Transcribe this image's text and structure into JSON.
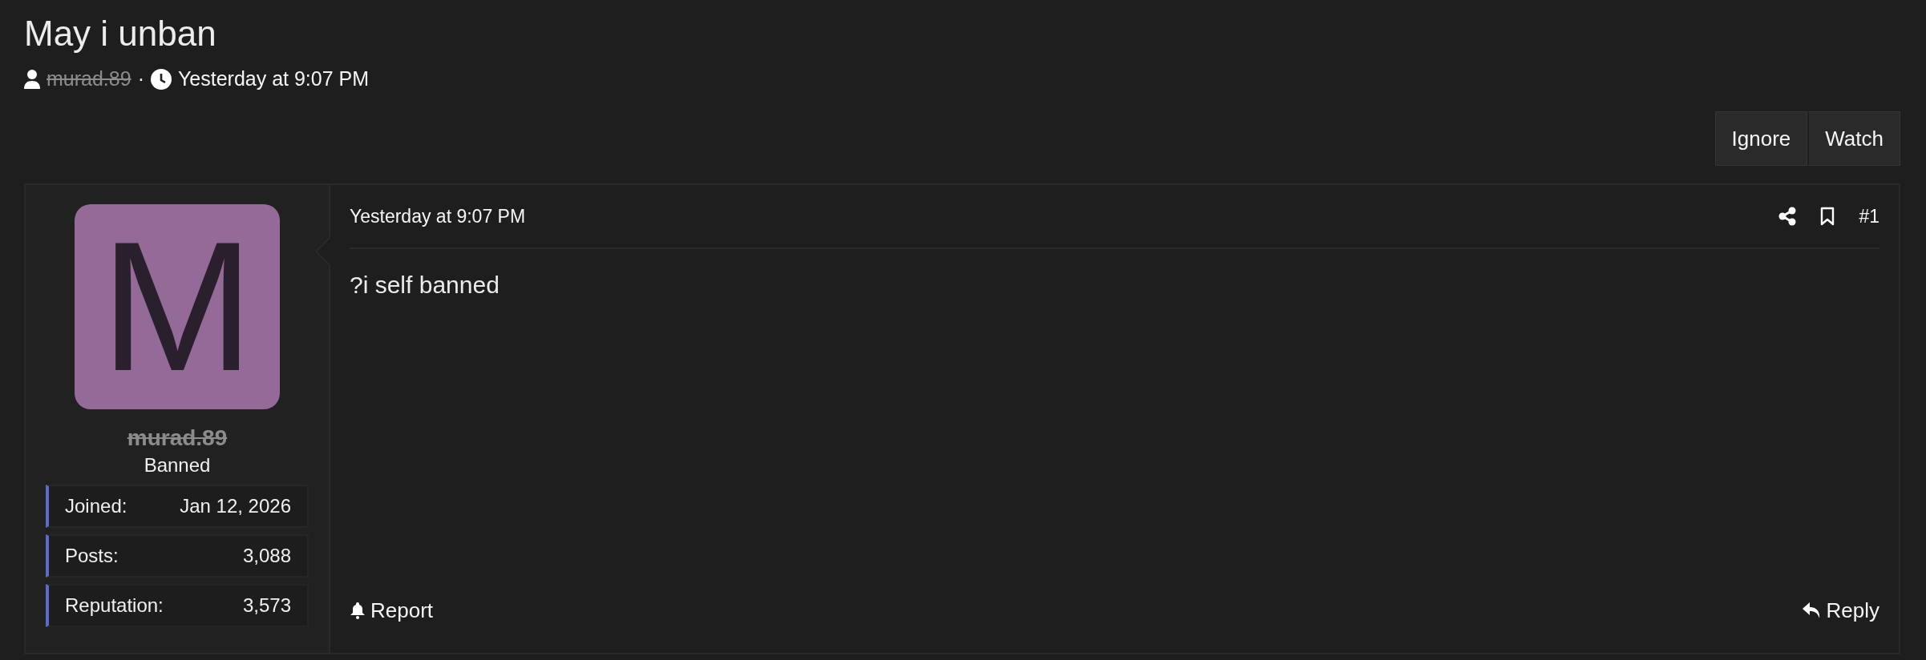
{
  "thread": {
    "title": "May i unban",
    "author": "murad.89",
    "author_struck": true,
    "separator": "·",
    "date": "Yesterday at 9:07 PM"
  },
  "thread_actions": [
    {
      "label": "Ignore"
    },
    {
      "label": "Watch"
    }
  ],
  "post": {
    "user": {
      "avatar_letter": "M",
      "username": "murad.89",
      "username_struck": true,
      "title": "Banned",
      "stats": [
        {
          "label": "Joined:",
          "value": "Jan 12, 2026"
        },
        {
          "label": "Posts:",
          "value": "3,088"
        },
        {
          "label": "Reputation:",
          "value": "3,573"
        }
      ]
    },
    "date": "Yesterday at 9:07 PM",
    "number": "#1",
    "body": "?i self banned",
    "actions": [
      {
        "kind": "report",
        "label": "Report"
      },
      {
        "kind": "reply",
        "label": "Reply"
      }
    ]
  }
}
